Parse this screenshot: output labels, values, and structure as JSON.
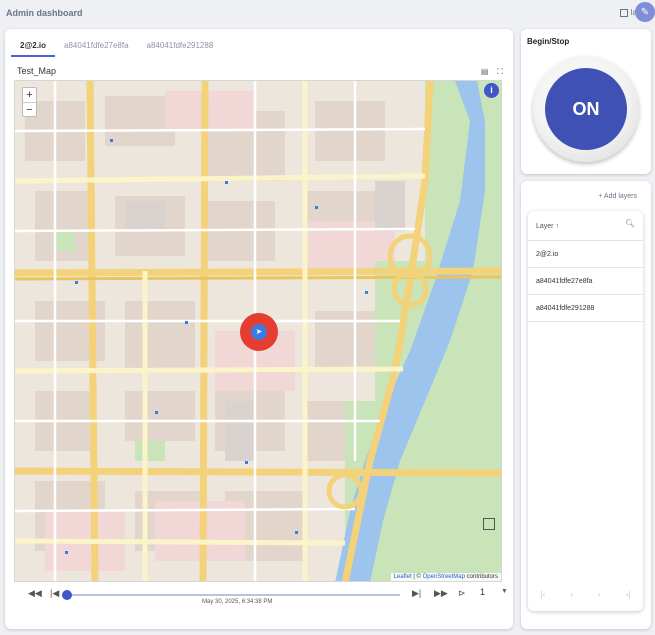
{
  "header": {
    "title": "Admin dashboard",
    "layout_label": "lay"
  },
  "tabs": [
    {
      "label": "2@2.io",
      "active": true
    },
    {
      "label": "a84041fdfe27e8fa",
      "active": false
    },
    {
      "label": "a84041fdfe291288",
      "active": false
    }
  ],
  "map_panel": {
    "title": "Test_Map",
    "zoom_in": "+",
    "zoom_out": "−",
    "info": "i",
    "attribution_leaflet": "Leaflet",
    "attribution_sep": "| ©",
    "attribution_osm": "OpenStreetMap",
    "attribution_tail": "contributors"
  },
  "timeline": {
    "date": "May 30, 2025, 6:34:38 PM",
    "speed": "1",
    "progress": 0.0
  },
  "begin_stop": {
    "title": "Begin/Stop",
    "button_label": "ON"
  },
  "layers": {
    "add_label": "Add layers",
    "column_header": "Layer",
    "items": [
      "2@2.io",
      "a84041fdfe27e8fa",
      "a84041fdfe291288"
    ]
  },
  "colors": {
    "accent": "#3f51b5",
    "marker": "#e53d2f",
    "river": "#9cc4ec",
    "park": "#c8e4b8"
  }
}
